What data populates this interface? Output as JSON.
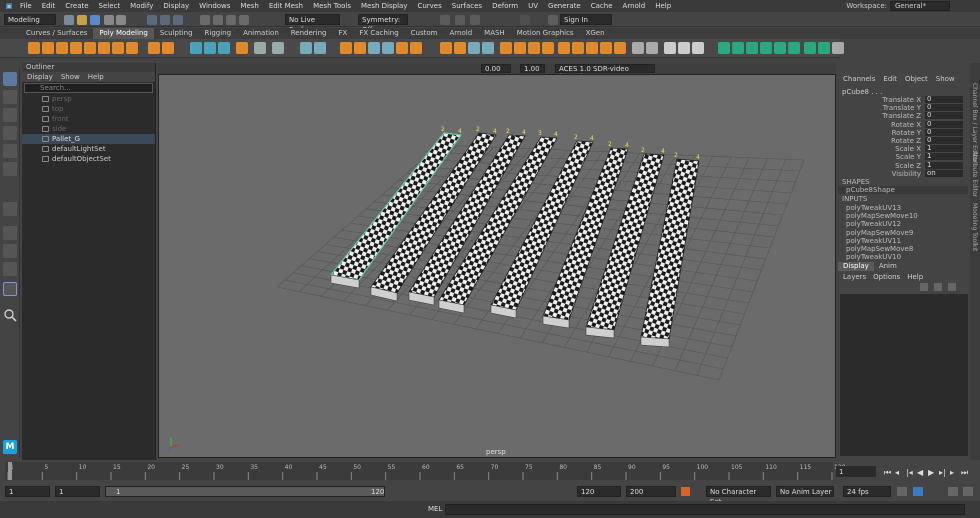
{
  "menubar": {
    "items": [
      "File",
      "Edit",
      "Create",
      "Select",
      "Modify",
      "Display",
      "Windows",
      "Mesh",
      "Edit Mesh",
      "Mesh Tools",
      "Mesh Display",
      "Curves",
      "Surfaces",
      "Deform",
      "UV",
      "Generate",
      "Cache",
      "Arnold",
      "Help"
    ],
    "workspace_label": "Workspace:",
    "workspace_value": "General*"
  },
  "status": {
    "mode": "Modeling",
    "live_surface": "No Live Surface",
    "symmetry": "Symmetry: Off",
    "sign_in": "Sign In"
  },
  "shelf_tabs": [
    "Curves / Surfaces",
    "Poly Modeling",
    "Sculpting",
    "Rigging",
    "Animation",
    "Rendering",
    "FX",
    "FX Caching",
    "Custom",
    "Arnold",
    "MASH",
    "Motion Graphics",
    "XGen"
  ],
  "shelf_active": 1,
  "outliner": {
    "title": "Outliner",
    "menu": [
      "Display",
      "Show",
      "Help"
    ],
    "search_placeholder": "Search...",
    "items": [
      {
        "label": "persp",
        "dim": true
      },
      {
        "label": "top",
        "dim": true
      },
      {
        "label": "front",
        "dim": true
      },
      {
        "label": "side",
        "dim": true
      },
      {
        "label": "Pallet_G",
        "dim": false,
        "sel": true
      },
      {
        "label": "defaultLightSet",
        "dim": false
      },
      {
        "label": "defaultObjectSet",
        "dim": false
      }
    ]
  },
  "viewport": {
    "camera_label": "persp",
    "exposure": "0.00",
    "gamma": "1.00",
    "color_space": "ACES 1.0 SDR-video (sRGB)",
    "vertex_labels": [
      "2",
      "4",
      "2",
      "4",
      "2",
      "4",
      "3",
      "4",
      "2",
      "4",
      "2",
      "4",
      "2",
      "4",
      "2",
      "4"
    ]
  },
  "channel_box": {
    "menu": [
      "Channels",
      "Edit",
      "Object",
      "Show"
    ],
    "object": "pCube8 . . .",
    "attrs": [
      {
        "label": "Translate X",
        "value": "0"
      },
      {
        "label": "Translate Y",
        "value": "0"
      },
      {
        "label": "Translate Z",
        "value": "0"
      },
      {
        "label": "Rotate X",
        "value": "0"
      },
      {
        "label": "Rotate Y",
        "value": "0"
      },
      {
        "label": "Rotate Z",
        "value": "0"
      },
      {
        "label": "Scale X",
        "value": "1"
      },
      {
        "label": "Scale Y",
        "value": "1"
      },
      {
        "label": "Scale Z",
        "value": "1"
      },
      {
        "label": "Visibility",
        "value": "on"
      }
    ],
    "shapes_label": "SHAPES",
    "shape": "pCube8Shape",
    "inputs_label": "INPUTS",
    "inputs": [
      "polyTweakUV13",
      "polyMapSewMove10",
      "polyTweakUV12",
      "polyMapSewMove9",
      "polyTweakUV11",
      "polyMapSewMove8",
      "polyTweakUV10"
    ]
  },
  "side_tabs": [
    "Channel Box / Layer Editor",
    "Attribute Editor",
    "Modeling Toolkit"
  ],
  "layer_editor": {
    "tabs": [
      "Display",
      "Anim"
    ],
    "menu": [
      "Layers",
      "Options",
      "Help"
    ]
  },
  "timeline": {
    "ticks": [
      "1",
      "5",
      "10",
      "15",
      "20",
      "25",
      "30",
      "35",
      "40",
      "45",
      "50",
      "55",
      "60",
      "65",
      "70",
      "75",
      "80",
      "85",
      "90",
      "95",
      "100",
      "105",
      "110",
      "115",
      "120"
    ],
    "current": "1"
  },
  "range": {
    "start": "1",
    "start2": "1",
    "slider_start": "1",
    "slider_end": "120",
    "end": "120",
    "end2": "200",
    "character_set": "No Character Set",
    "anim_layer": "No Anim Layer",
    "fps": "24 fps"
  },
  "cmdline": {
    "label": "MEL"
  }
}
